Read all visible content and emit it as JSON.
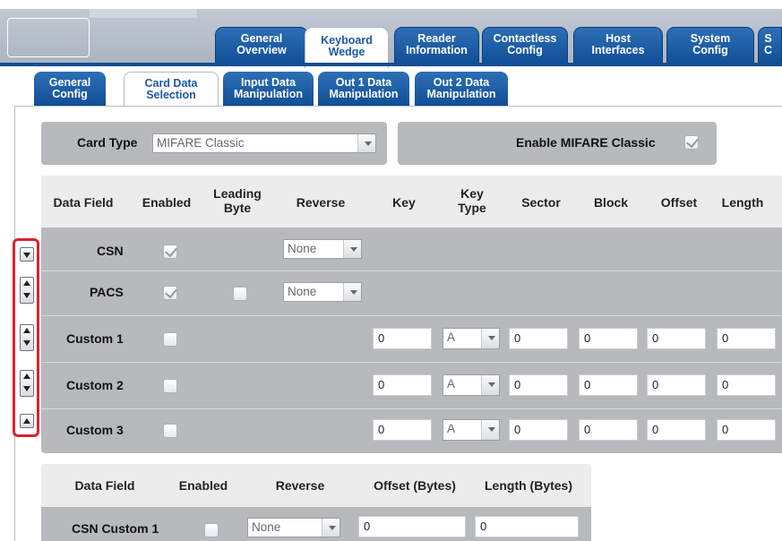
{
  "main_tabs": [
    {
      "line1": "General",
      "line2": "Overview"
    },
    {
      "line1": "Keyboard",
      "line2": "Wedge"
    },
    {
      "line1": "Reader",
      "line2": "Information"
    },
    {
      "line1": "Contactless",
      "line2": "Config"
    },
    {
      "line1": "Host",
      "line2": "Interfaces"
    },
    {
      "line1": "System",
      "line2": "Config"
    },
    {
      "line1": "S",
      "line2": "C"
    }
  ],
  "sub_tabs": [
    {
      "line1": "General",
      "line2": "Config"
    },
    {
      "line1": "Card Data",
      "line2": "Selection"
    },
    {
      "line1": "Input Data",
      "line2": "Manipulation"
    },
    {
      "line1": "Out 1 Data",
      "line2": "Manipulation"
    },
    {
      "line1": "Out 2 Data",
      "line2": "Manipulation"
    }
  ],
  "card_type": {
    "label": "Card Type",
    "value": "MIFARE Classic"
  },
  "enable": {
    "label": "Enable MIFARE Classic",
    "checked": true
  },
  "table1": {
    "headers": {
      "data_field": "Data Field",
      "enabled": "Enabled",
      "leading_l1": "Leading",
      "leading_l2": "Byte",
      "reverse": "Reverse",
      "key": "Key",
      "keytype_l1": "Key",
      "keytype_l2": "Type",
      "sector": "Sector",
      "block": "Block",
      "offset": "Offset",
      "length": "Length"
    },
    "rows": [
      {
        "name": "CSN",
        "reverse": "None"
      },
      {
        "name": "PACS",
        "reverse": "None"
      },
      {
        "name": "Custom 1",
        "key": "0",
        "keytype": "A",
        "sector": "0",
        "block": "0",
        "offset": "0",
        "length": "0"
      },
      {
        "name": "Custom 2",
        "key": "0",
        "keytype": "A",
        "sector": "0",
        "block": "0",
        "offset": "0",
        "length": "0"
      },
      {
        "name": "Custom 3",
        "key": "0",
        "keytype": "A",
        "sector": "0",
        "block": "0",
        "offset": "0",
        "length": "0"
      }
    ]
  },
  "table2": {
    "headers": {
      "data_field": "Data Field",
      "enabled": "Enabled",
      "reverse": "Reverse",
      "offset": "Offset (Bytes)",
      "length": "Length (Bytes)"
    },
    "rows": [
      {
        "name": "CSN Custom 1",
        "reverse": "None",
        "offset": "0",
        "length": "0"
      }
    ]
  },
  "colors": {
    "tab_blue": "#1b5aa4",
    "highlight": "#e0202a",
    "panel_gray": "#b7b9bc"
  }
}
